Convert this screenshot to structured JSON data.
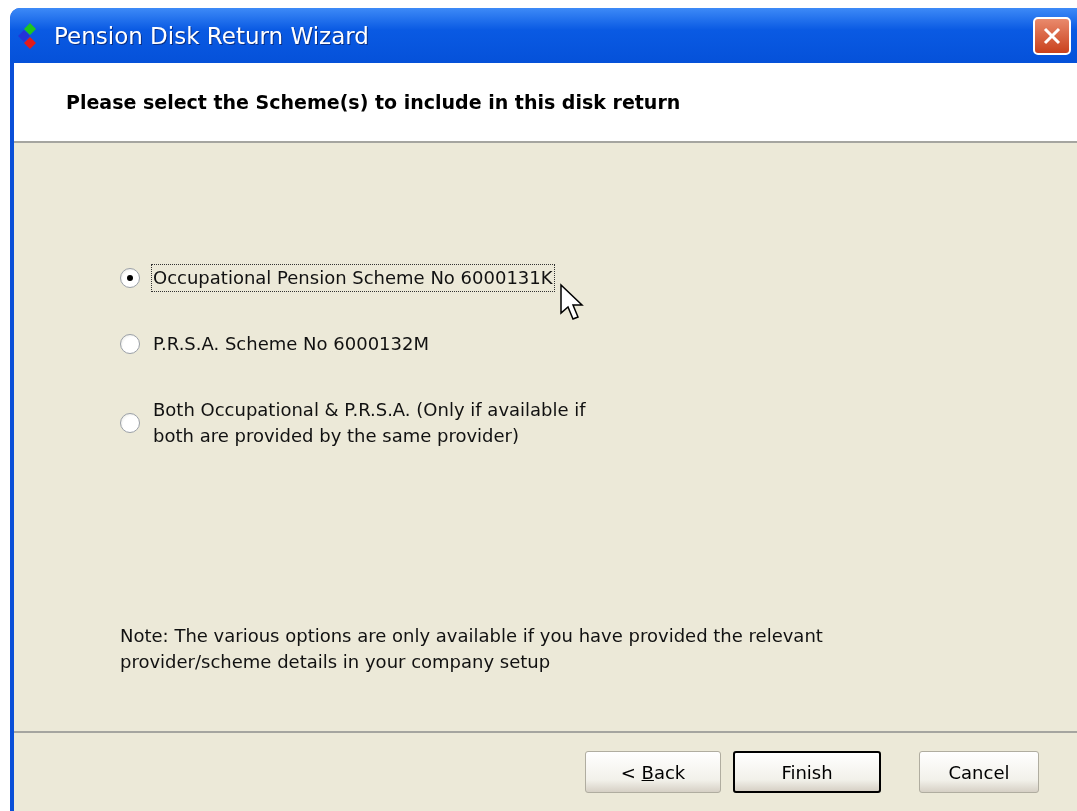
{
  "window": {
    "title": "Pension Disk Return Wizard"
  },
  "header": {
    "heading": "Please select the Scheme(s) to include in this disk return"
  },
  "options": [
    {
      "label": "Occupational Pension Scheme No 6000131K",
      "selected": true,
      "focused": true
    },
    {
      "label": "P.R.S.A. Scheme No 6000132M",
      "selected": false,
      "focused": false
    },
    {
      "label": "Both Occupational & P.R.S.A. (Only if available if both are provided by the same provider)",
      "selected": false,
      "focused": false
    }
  ],
  "note": "Note: The various options are only available if you have provided the relevant provider/scheme details in your company setup",
  "buttons": [
    {
      "prefix": "< ",
      "access_key": "B",
      "suffix": "ack",
      "default": false
    },
    {
      "prefix": "Finish",
      "default": true
    },
    {
      "prefix": "Cancel",
      "default": false
    }
  ]
}
